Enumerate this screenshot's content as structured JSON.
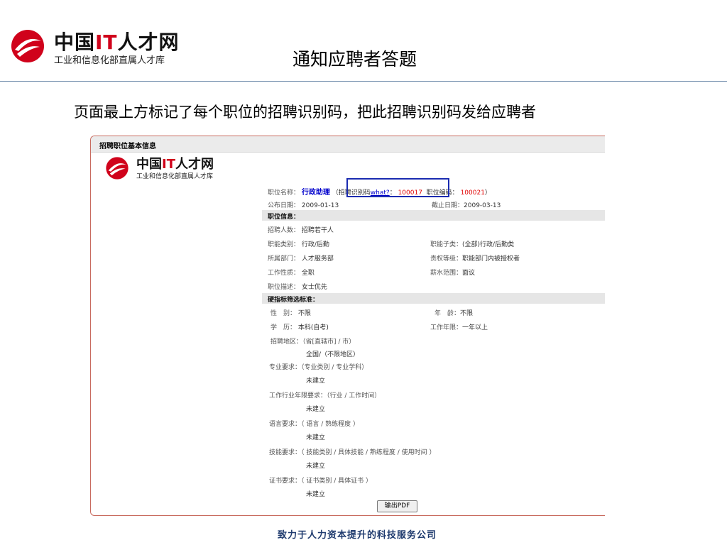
{
  "logo": {
    "brand_prefix": "中国",
    "brand_it": "IT",
    "brand_suffix": "人才网",
    "subtitle": "工业和信息化部直属人才库"
  },
  "slide": {
    "title": "通知应聘者答题",
    "description": "页面最上方标记了每个职位的招聘识别码，把此招聘识别码发给应聘者",
    "footer": "致力于人力资本提升的科技服务公司"
  },
  "colors": {
    "brand_red": "#d0021b",
    "highlight_box": "#1a2bb0",
    "link": "#0000cc",
    "footer": "#1e3a6e"
  },
  "page": {
    "header": "招聘职位基本信息",
    "job": {
      "name_label": "职位名称：",
      "name": "行政助理",
      "paren_open": "（",
      "code_label": "招聘识别码",
      "what_link": "what?",
      "colon": "：",
      "code": "100017",
      "job_no_label": "职位编码：",
      "job_no": "100021",
      "paren_close": "）",
      "publish_label": "公布日期：",
      "publish_date": "2009-01-13",
      "deadline_label": "截止日期：",
      "deadline": "2009-03-13"
    },
    "section_info": "职位信息：",
    "info": {
      "headcount_label": "招聘人数：",
      "headcount": "招聘若干人",
      "category_label": "职能类别：",
      "category": "行政/后勤",
      "subcategory_label": "职能子类：",
      "subcategory": "(全部)行政/后勤类",
      "dept_label": "所属部门：",
      "dept": "人才服务部",
      "auth_label": "责权等级：",
      "auth": "职能部门内被授权者",
      "nature_label": "工作性质：",
      "nature": "全职",
      "salary_label": "薪水范围：",
      "salary": "面议",
      "desc_label": "职位描述：",
      "desc": "女士优先"
    },
    "section_criteria": "硬指标筛选标准：",
    "criteria": {
      "gender_label": "性　别：",
      "gender": "不限",
      "age_label": "年　龄：",
      "age": "不限",
      "edu_label": "学　历：",
      "edu": "本科(自考)",
      "years_label": "工作年限：",
      "years": "一年以上",
      "region_label": "招聘地区：",
      "region_hint": "（省[直辖市] / 市）",
      "region_value": "全国/（不限地区）",
      "major_label": "专业要求：",
      "major_hint": "（专业类别 / 专业学科）",
      "major_value": "未建立",
      "industry_label": "工作行业年限要求：",
      "industry_hint": "（行业 / 工作时间）",
      "industry_value": "未建立",
      "lang_label": "语言要求：",
      "lang_hint": "（ 语言 / 熟练程度 ）",
      "lang_value": "未建立",
      "skill_label": "技能要求：",
      "skill_hint": "（ 技能类别 / 具体技能 / 熟练程度 / 使用时间 ）",
      "skill_value": "未建立",
      "cert_label": "证书要求：",
      "cert_hint": "（ 证书类别 / 具体证书 ）",
      "cert_value": "未建立"
    },
    "pdf_button": "输出PDF"
  }
}
